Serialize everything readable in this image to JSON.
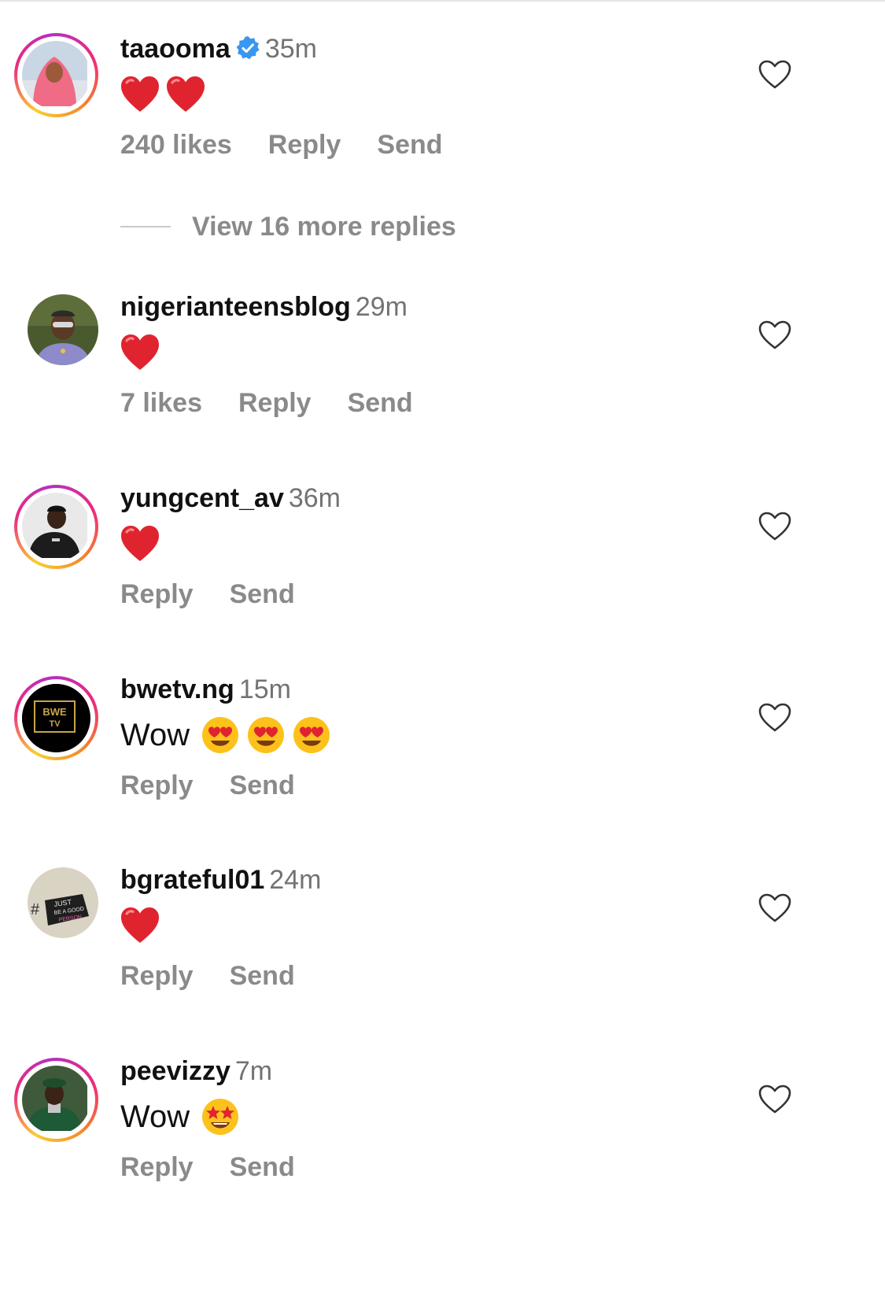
{
  "colors": {
    "username": "#111111",
    "secondary_text": "#737373",
    "action_text": "#8a8a8a",
    "verified_badge": "#3897f0",
    "heart_emoji": "#e0242f"
  },
  "comments": [
    {
      "username": "taaooma",
      "verified": true,
      "time": "35m",
      "text": "",
      "emojis": [
        "red-heart",
        "red-heart"
      ],
      "likes": "240 likes",
      "reply": "Reply",
      "send": "Send",
      "story_ring": true
    },
    {
      "username": "nigerianteensblog",
      "verified": false,
      "time": "29m",
      "text": "",
      "emojis": [
        "red-heart"
      ],
      "likes": "7 likes",
      "reply": "Reply",
      "send": "Send",
      "story_ring": false
    },
    {
      "username": "yungcent_av",
      "verified": false,
      "time": "36m",
      "text": "",
      "emojis": [
        "red-heart"
      ],
      "reply": "Reply",
      "send": "Send",
      "story_ring": true
    },
    {
      "username": "bwetv.ng",
      "verified": false,
      "time": "15m",
      "text": "Wow",
      "emojis": [
        "heart-eyes",
        "heart-eyes",
        "heart-eyes"
      ],
      "reply": "Reply",
      "send": "Send",
      "story_ring": true,
      "avatar_text": "BWE TV"
    },
    {
      "username": "bgrateful01",
      "verified": false,
      "time": "24m",
      "text": "",
      "emojis": [
        "red-heart"
      ],
      "reply": "Reply",
      "send": "Send",
      "story_ring": false,
      "avatar_text": "# JUST BE A GOOD PERSON"
    },
    {
      "username": "peevizzy",
      "verified": false,
      "time": "7m",
      "text": "Wow",
      "emojis": [
        "star-struck"
      ],
      "reply": "Reply",
      "send": "Send",
      "story_ring": true
    }
  ],
  "view_more_replies": "View 16 more replies",
  "icons": {
    "like": "heart-outline-icon",
    "verified": "verified-badge-icon"
  }
}
